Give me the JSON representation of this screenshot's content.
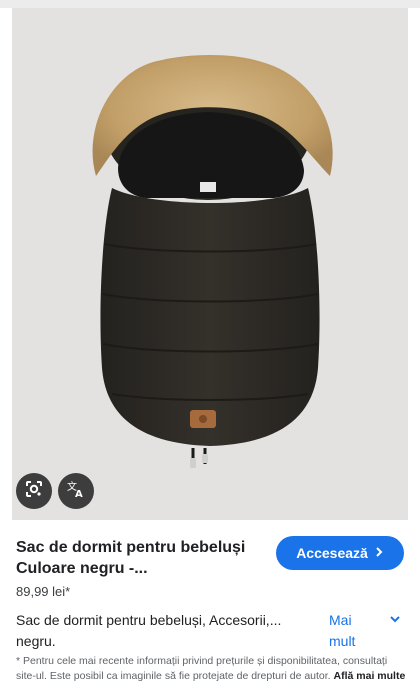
{
  "product": {
    "title": "Sac de dormit pentru bebeluși Culoare negru -...",
    "price": "89,99 lei*",
    "description": "Sac de dormit pentru bebeluși, Accesorii,... negru.",
    "more_label": "Mai mult",
    "disclaimer": "* Pentru cele mai recente informații privind prețurile și disponibilitatea, consultați site-ul. Este posibil ca imaginile să fie protejate de drepturi de autor.",
    "learn_more_label": "Află mai multe"
  },
  "actions": {
    "visit_label": "Accesează",
    "lens_icon": "google-lens-icon",
    "translate_icon": "translate-icon"
  },
  "colors": {
    "accent": "#1a73e8",
    "bag": "#2f2c27",
    "fur": "#c9a873",
    "image_bg": "#e3e2e0",
    "overlay_button": "#3d3d3d"
  }
}
